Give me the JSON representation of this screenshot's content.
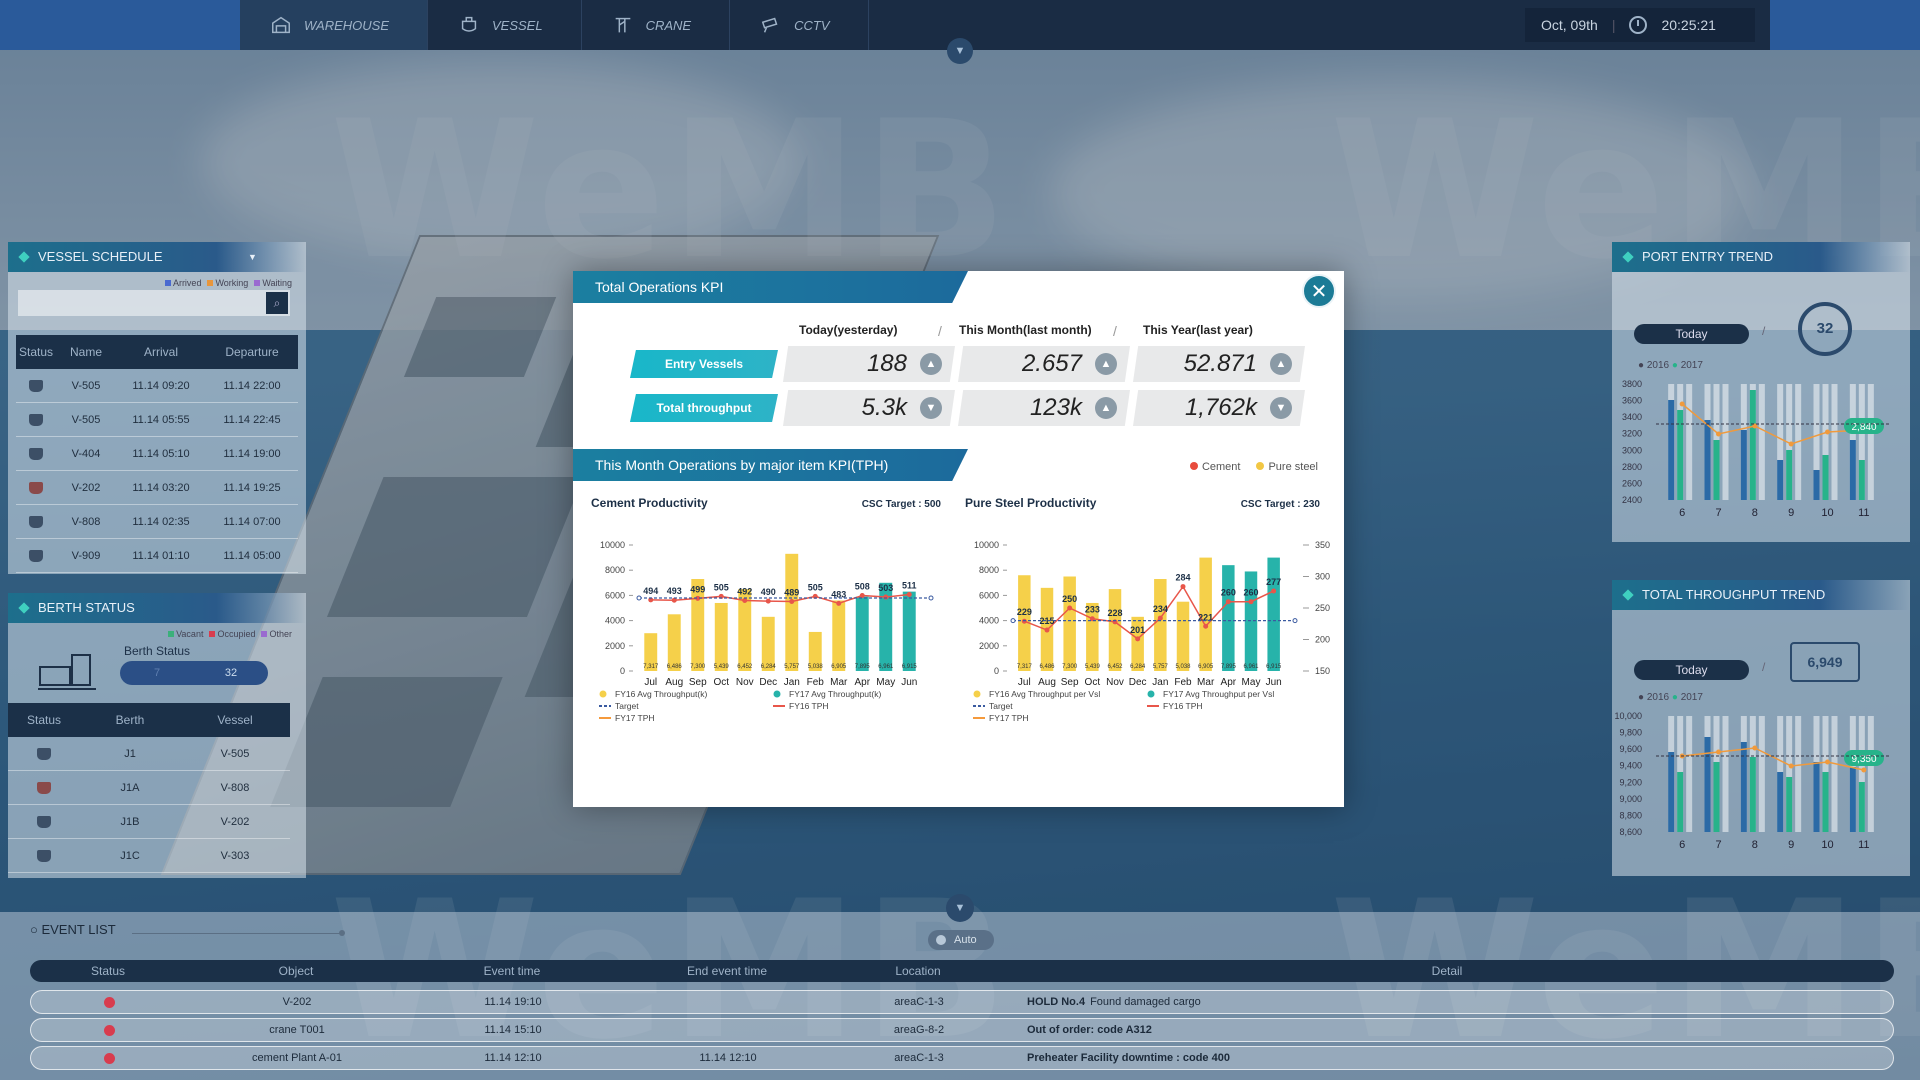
{
  "nav": {
    "items": [
      {
        "label": "WAREHOUSE",
        "icon": "warehouse-icon"
      },
      {
        "label": "VESSEL",
        "icon": "vessel-icon"
      },
      {
        "label": "CRANE",
        "icon": "crane-icon"
      },
      {
        "label": "CCTV",
        "icon": "cctv-icon"
      }
    ],
    "date": "Oct, 09th",
    "separator": "|",
    "time": "20:25:21"
  },
  "watermark": "WeMB",
  "vessel_schedule": {
    "title": "VESSEL SCHEDULE",
    "legend": [
      "Arrived",
      "Working",
      "Waiting"
    ],
    "columns": [
      "Status",
      "Name",
      "Arrival",
      "Departure"
    ],
    "rows": [
      {
        "name": "V-505",
        "arrival": "11.14 09:20",
        "departure": "11.14 22:00"
      },
      {
        "name": "V-505",
        "arrival": "11.14 05:55",
        "departure": "11.14 22:45"
      },
      {
        "name": "V-404",
        "arrival": "11.14 05:10",
        "departure": "11.14 19:00"
      },
      {
        "name": "V-202",
        "arrival": "11.14 03:20",
        "departure": "11.14 19:25"
      },
      {
        "name": "V-808",
        "arrival": "11.14 02:35",
        "departure": "11.14 07:00"
      },
      {
        "name": "V-909",
        "arrival": "11.14 01:10",
        "departure": "11.14 05:00"
      }
    ]
  },
  "berth_status": {
    "title": "BERTH STATUS",
    "legend": [
      "Vacant",
      "Occupied",
      "Other"
    ],
    "label": "Berth Status",
    "vacant": "7",
    "occupied": "32",
    "columns": [
      "Status",
      "Berth",
      "Vessel"
    ],
    "rows": [
      {
        "berth": "J1",
        "vessel": "V-505"
      },
      {
        "berth": "J1A",
        "vessel": "V-808"
      },
      {
        "berth": "J1B",
        "vessel": "V-202"
      },
      {
        "berth": "J1C",
        "vessel": "V-303"
      }
    ]
  },
  "port_entry": {
    "title": "PORT ENTRY TREND",
    "today": "Today",
    "slash": "/",
    "gauge": "32",
    "legend": [
      "2016",
      "2017"
    ],
    "yticks": [
      "3800",
      "3600",
      "3400",
      "3200",
      "3000",
      "2800",
      "2600",
      "2400"
    ],
    "xticks": [
      "6",
      "7",
      "8",
      "9",
      "10",
      "11"
    ],
    "badge": "2,840"
  },
  "throughput_trend": {
    "title": "TOTAL THROUGHPUT TREND",
    "today": "Today",
    "slash": "/",
    "gauge": "6,949",
    "legend": [
      "2016",
      "2017"
    ],
    "yticks": [
      "10,000",
      "9,800",
      "9,600",
      "9,400",
      "9,200",
      "9,000",
      "8,800",
      "8,600"
    ],
    "xticks": [
      "6",
      "7",
      "8",
      "9",
      "10",
      "11"
    ],
    "badge": "9,350"
  },
  "modal": {
    "title": "Total Operations KPI",
    "headers": [
      "Today(yesterday)",
      "This Month(last month)",
      "This Year(last year)"
    ],
    "sep": "/",
    "rows": [
      {
        "label": "Entry Vessels",
        "values": [
          "188",
          "2.657",
          "52.871"
        ],
        "arrows": [
          "up",
          "up",
          "up"
        ]
      },
      {
        "label": "Total throughput",
        "values": [
          "5.3k",
          "123k",
          "1,762k"
        ],
        "arrows": [
          "down",
          "up",
          "down"
        ]
      }
    ],
    "section_title": "This Month Operations by major item KPI(TPH)",
    "legend": [
      {
        "label": "Cement",
        "color": "#e84c3d"
      },
      {
        "label": "Pure steel",
        "color": "#f2c744"
      }
    ],
    "close_icon": "close-icon",
    "colors": {
      "fy16_bar": "#f5d04a",
      "fy17_bar": "#27b3aa",
      "fy16_line": "#e8564a",
      "fy17_line": "#f59a3c",
      "target": "#3a5aa0"
    }
  },
  "chart_data": [
    {
      "type": "bar",
      "title": "Cement Productivity",
      "subtitle": "CSC Target : 500",
      "categories": [
        "Jul",
        "Aug",
        "Sep",
        "Oct",
        "Nov",
        "Dec",
        "Jan",
        "Feb",
        "Mar",
        "Apr",
        "May",
        "Jun"
      ],
      "ylim": [
        0,
        10000
      ],
      "yticks": [
        "10000",
        "8000",
        "6000",
        "4000",
        "2000",
        "0"
      ],
      "series": [
        {
          "name": "FY16 Avg Throughput(k)",
          "values": [
            3000,
            4500,
            7300,
            5400,
            6500,
            4300,
            9300,
            3100,
            5600,
            null,
            null,
            null
          ]
        },
        {
          "name": "FY17 Avg Throughput(k)",
          "values": [
            null,
            null,
            null,
            null,
            null,
            null,
            null,
            null,
            null,
            5900,
            7000,
            6300
          ]
        },
        {
          "name": "FY16 TPH",
          "values": [
            494,
            493,
            499,
            505,
            492,
            490,
            489,
            505,
            483,
            508,
            503,
            511
          ]
        },
        {
          "name": "Target",
          "values": [
            500,
            500,
            500,
            500,
            500,
            500,
            500,
            500,
            500,
            500,
            500,
            500
          ]
        }
      ],
      "data_labels": [
        "494",
        "493",
        "499",
        "505",
        "492",
        "490",
        "489",
        "505",
        "483",
        "508",
        "503",
        "511"
      ],
      "bar_labels": [
        "7,317",
        "6,486",
        "7,300",
        "5,439",
        "6,452",
        "6,284",
        "5,757",
        "5,038",
        "6,905",
        "7,895",
        "6,961",
        "6,915"
      ],
      "legend": [
        "FY16 Avg Throughput(k)",
        "FY17 Avg Throughput(k)",
        "Target",
        "FY16 TPH",
        "FY17 TPH"
      ]
    },
    {
      "type": "bar",
      "title": "Pure Steel Productivity",
      "subtitle": "CSC Target : 230",
      "categories": [
        "Jul",
        "Aug",
        "Sep",
        "Oct",
        "Nov",
        "Dec",
        "Jan",
        "Feb",
        "Mar",
        "Apr",
        "May",
        "Jun"
      ],
      "ylim": [
        0,
        10000
      ],
      "y2lim": [
        150,
        350
      ],
      "yticks": [
        "10000",
        "8000",
        "6000",
        "4000",
        "2000",
        "0"
      ],
      "y2ticks": [
        "350",
        "300",
        "250",
        "200",
        "150"
      ],
      "series": [
        {
          "name": "FY16 Avg Throughput per Vsl",
          "values": [
            7600,
            6600,
            7500,
            5400,
            6500,
            4300,
            7300,
            5500,
            9000,
            null,
            null,
            null
          ]
        },
        {
          "name": "FY17 Avg Throughput per Vsl",
          "values": [
            null,
            null,
            null,
            null,
            null,
            null,
            null,
            null,
            null,
            8400,
            7900,
            9000
          ]
        },
        {
          "name": "FY16 TPH",
          "values": [
            229,
            215,
            250,
            233,
            228,
            201,
            234,
            284,
            221,
            260,
            260,
            277
          ]
        },
        {
          "name": "Target",
          "values": [
            230,
            230,
            230,
            230,
            230,
            230,
            230,
            230,
            230,
            230,
            230,
            230
          ]
        }
      ],
      "data_labels": [
        "229",
        "215",
        "250",
        "233",
        "228",
        "201",
        "234",
        "284",
        "221",
        "260",
        "260",
        "277"
      ],
      "bar_labels": [
        "7,317",
        "6,486",
        "7,300",
        "5,439",
        "6,452",
        "6,284",
        "5,757",
        "5,038",
        "6,905",
        "7,895",
        "6,961",
        "6,915"
      ],
      "legend": [
        "FY16 Avg Throughput per Vsl",
        "FY17 Avg Throughput per Vsl",
        "Target",
        "FY16 TPH",
        "FY17 TPH"
      ]
    }
  ],
  "events": {
    "title": "EVENT LIST",
    "auto": "Auto",
    "columns": [
      "Status",
      "Object",
      "Event time",
      "End event time",
      "Location",
      "Detail"
    ],
    "rows": [
      {
        "object": "V-202",
        "event_time": "11.14 19:10",
        "end_time": "",
        "location": "areaC-1-3",
        "detail_bold": "HOLD No.4",
        "detail": "Found damaged cargo"
      },
      {
        "object": "crane T001",
        "event_time": "11.14 15:10",
        "end_time": "",
        "location": "areaG-8-2",
        "detail_bold": "Out of order: code A312",
        "detail": ""
      },
      {
        "object": "cement Plant A-01",
        "event_time": "11.14 12:10",
        "end_time": "11.14 12:10",
        "location": "areaC-1-3",
        "detail_bold": "Preheater Facility downtime : code 400",
        "detail": ""
      }
    ]
  }
}
